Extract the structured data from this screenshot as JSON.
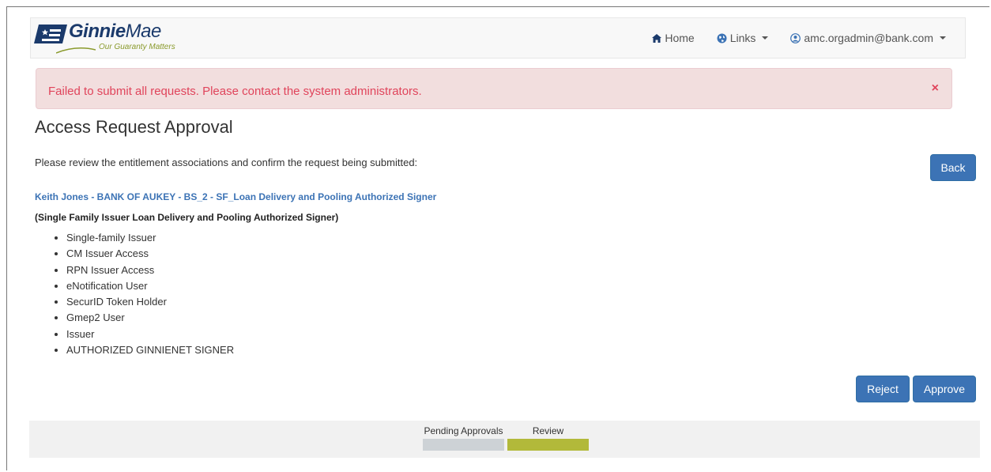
{
  "navbar": {
    "brand_part1": "Ginnie",
    "brand_part2": "Mae",
    "tagline": "Our Guaranty Matters",
    "home_label": "Home",
    "links_label": "Links",
    "user_label": "amc.orgadmin@bank.com"
  },
  "alert": {
    "message": "Failed to submit all requests. Please contact the system administrators.",
    "close_symbol": "×"
  },
  "page": {
    "title": "Access Request Approval",
    "instructions": "Please review the entitlement associations and confirm the request being submitted:",
    "back_label": "Back",
    "reject_label": "Reject",
    "approve_label": "Approve"
  },
  "request": {
    "link_text": "Keith Jones - BANK OF AUKEY - BS_2 - SF_Loan Delivery and Pooling Authorized Signer",
    "role_description": "(Single Family Issuer Loan Delivery and Pooling Authorized Signer)",
    "entitlements": [
      "Single-family Issuer",
      "CM Issuer Access",
      "RPN Issuer Access",
      "eNotification User",
      "SecurID Token Holder",
      "Gmep2 User",
      "Issuer",
      "AUTHORIZED GINNIENET SIGNER"
    ]
  },
  "progress": {
    "steps": [
      {
        "label": "Pending Approvals",
        "state": "completed"
      },
      {
        "label": "Review",
        "state": "active"
      }
    ]
  },
  "colors": {
    "brand_navy": "#1b3a6b",
    "tagline_green": "#8a9a2c",
    "primary_button": "#3c73b5",
    "alert_bg": "#f2dede",
    "alert_text": "#e0445b",
    "link": "#3c73b5",
    "step_done": "#cdd2d6",
    "step_active": "#b2b93a"
  }
}
